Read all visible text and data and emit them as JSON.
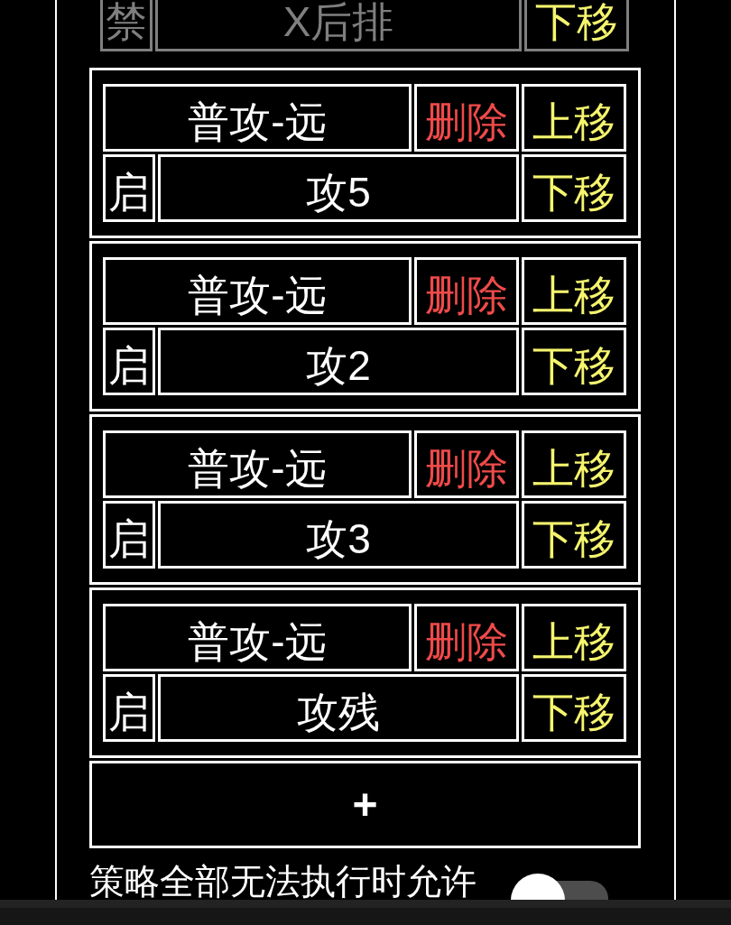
{
  "strategies": [
    {
      "enabled": false,
      "toggle": "禁",
      "target": "X后排",
      "move_down": "下移"
    },
    {
      "enabled": true,
      "action": "普攻-远",
      "delete": "删除",
      "move_up": "上移",
      "toggle": "启",
      "target": "攻5",
      "move_down": "下移"
    },
    {
      "enabled": true,
      "action": "普攻-远",
      "delete": "删除",
      "move_up": "上移",
      "toggle": "启",
      "target": "攻2",
      "move_down": "下移"
    },
    {
      "enabled": true,
      "action": "普攻-远",
      "delete": "删除",
      "move_up": "上移",
      "toggle": "启",
      "target": "攻3",
      "move_down": "下移"
    },
    {
      "enabled": true,
      "action": "普攻-远",
      "delete": "删除",
      "move_up": "上移",
      "toggle": "启",
      "target": "攻残",
      "move_down": "下移"
    }
  ],
  "add_button": "+",
  "fallback_setting": {
    "label": "策略全部无法执行时允许",
    "on": false
  }
}
